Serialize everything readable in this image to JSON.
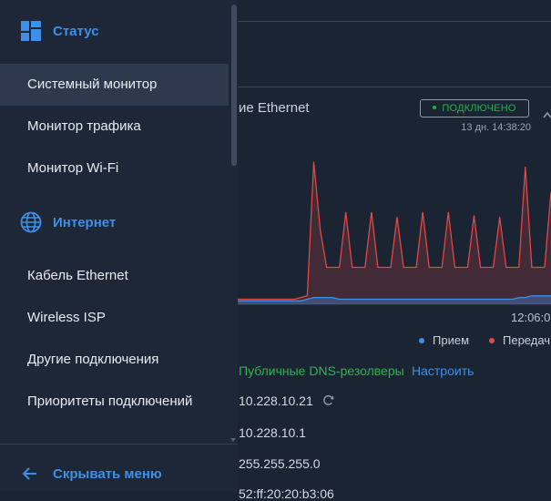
{
  "sidebar": {
    "status_section": {
      "label": "Статус",
      "icon": "dashboard-icon"
    },
    "status_items": [
      {
        "label": "Системный монитор",
        "active": true
      },
      {
        "label": "Монитор трафика"
      },
      {
        "label": "Монитор Wi-Fi"
      }
    ],
    "internet_section": {
      "label": "Интернет",
      "icon": "globe-icon"
    },
    "internet_items": [
      {
        "label": "Кабель Ethernet"
      },
      {
        "label": "Wireless ISP"
      },
      {
        "label": "Другие подключения"
      },
      {
        "label": "Приоритеты подключений"
      }
    ],
    "hide_menu": {
      "label": "Скрывать меню",
      "icon": "arrow-left-icon"
    }
  },
  "main": {
    "connection_title": "ие Ethernet",
    "status_badge": "ПОДКЛЮЧЕНО",
    "uptime": "13 дн. 14:38:20",
    "time_tick": "12:06:0",
    "legend": [
      {
        "label": "Прием",
        "color": "#3d90e8"
      },
      {
        "label": "Передач",
        "color": "#e04848"
      }
    ],
    "dns_label": "Публичные DNS-резолверы",
    "dns_configure": "Настроить",
    "info_rows": [
      "10.228.10.21",
      "10.228.10.1",
      "255.255.255.0",
      "52:ff:20:20:b3:06"
    ]
  },
  "colors": {
    "accent": "#3d90e8",
    "success": "#22b14c",
    "transmit": "#e04848",
    "receive": "#3d90e8"
  },
  "chart_data": {
    "type": "area",
    "x": [
      0,
      1,
      2,
      3,
      4,
      5,
      6,
      7,
      8,
      9,
      10,
      11,
      12,
      13,
      14,
      15,
      16,
      17,
      18,
      19,
      20,
      21,
      22,
      23,
      24,
      25,
      26,
      27,
      28,
      29,
      30,
      31,
      32,
      33,
      34,
      35,
      36,
      37,
      38,
      39,
      40,
      41,
      42,
      43,
      44,
      45,
      46,
      47,
      48,
      49
    ],
    "series": [
      {
        "name": "Передач",
        "color": "#e04848",
        "values": [
          3,
          3,
          3,
          3,
          3,
          3,
          3,
          3,
          3,
          3,
          4,
          5,
          85,
          45,
          22,
          22,
          22,
          55,
          22,
          22,
          22,
          55,
          22,
          22,
          22,
          52,
          22,
          22,
          22,
          55,
          22,
          22,
          22,
          55,
          22,
          22,
          22,
          53,
          22,
          22,
          22,
          52,
          22,
          22,
          22,
          82,
          22,
          22,
          22,
          67
        ]
      },
      {
        "name": "Прием",
        "color": "#3d90e8",
        "values": [
          2,
          2,
          2,
          2,
          2,
          2,
          2,
          2,
          2,
          2,
          2,
          3,
          4,
          4,
          4,
          4,
          3,
          3,
          3,
          3,
          3,
          3,
          3,
          3,
          3,
          3,
          3,
          3,
          3,
          3,
          3,
          3,
          3,
          3,
          3,
          3,
          3,
          3,
          3,
          3,
          3,
          3,
          3,
          3,
          4,
          4,
          5,
          5,
          5,
          5
        ]
      }
    ],
    "ylim": [
      0,
      100
    ],
    "xtick_labels": [
      "12:06:0"
    ]
  }
}
